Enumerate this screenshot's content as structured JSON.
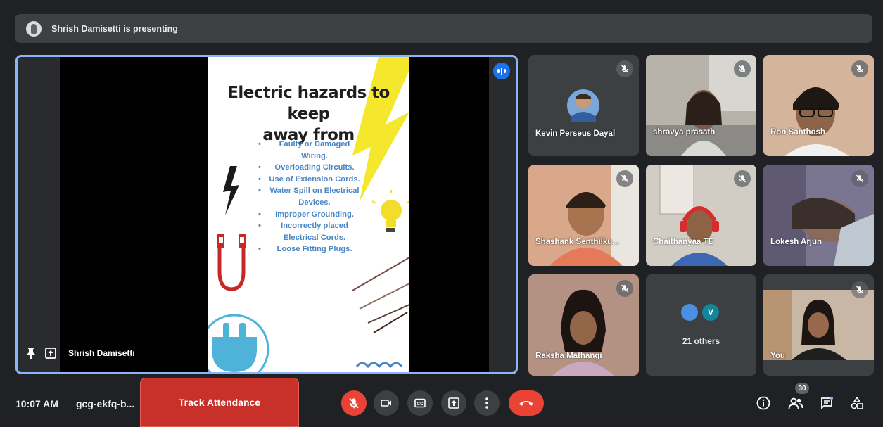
{
  "banner": {
    "text": "Shrish Damisetti is presenting"
  },
  "main": {
    "presenter_name": "Shrish Damisetti",
    "slide": {
      "title_line1": "Electric hazards to keep",
      "title_line2": "away from",
      "bullets": [
        "Faulty or Damaged Wiring.",
        "Overloading Circuits.",
        "Use of Extension Cords.",
        "Water Spill on Electrical Devices.",
        "Improper Grounding.",
        "Incorrectly placed Electrical Cords.",
        "Loose Fitting Plugs."
      ]
    }
  },
  "participants": [
    {
      "name": "Kevin Perseus Dayal"
    },
    {
      "name": "shravya prasath"
    },
    {
      "name": "Ron Santhosh"
    },
    {
      "name": "Shashank Senthilku..."
    },
    {
      "name": "Chaithanyaa TE"
    },
    {
      "name": "Lokesh Arjun"
    },
    {
      "name": "Raksha Mathangi"
    },
    {
      "name": "21 others",
      "avatar_letter": "V"
    },
    {
      "name": "You"
    }
  ],
  "bottom": {
    "time": "10:07 AM",
    "meeting_code": "gcg-ekfq-b...",
    "track_attendance": "Track Attendance",
    "people_count": "30"
  },
  "colors": {
    "background": "#202124",
    "tile": "#3c4043",
    "accent_blue": "#1a73e8",
    "danger_red": "#ea4335",
    "track_red": "#c8302a",
    "slide_bullet_blue": "#4a86c5"
  },
  "icons": [
    "mic-off-icon",
    "camera-icon",
    "captions-icon",
    "present-icon",
    "more-options-icon",
    "hang-up-icon",
    "info-icon",
    "people-icon",
    "chat-icon",
    "activities-icon",
    "pin-icon",
    "speaking-icon"
  ]
}
